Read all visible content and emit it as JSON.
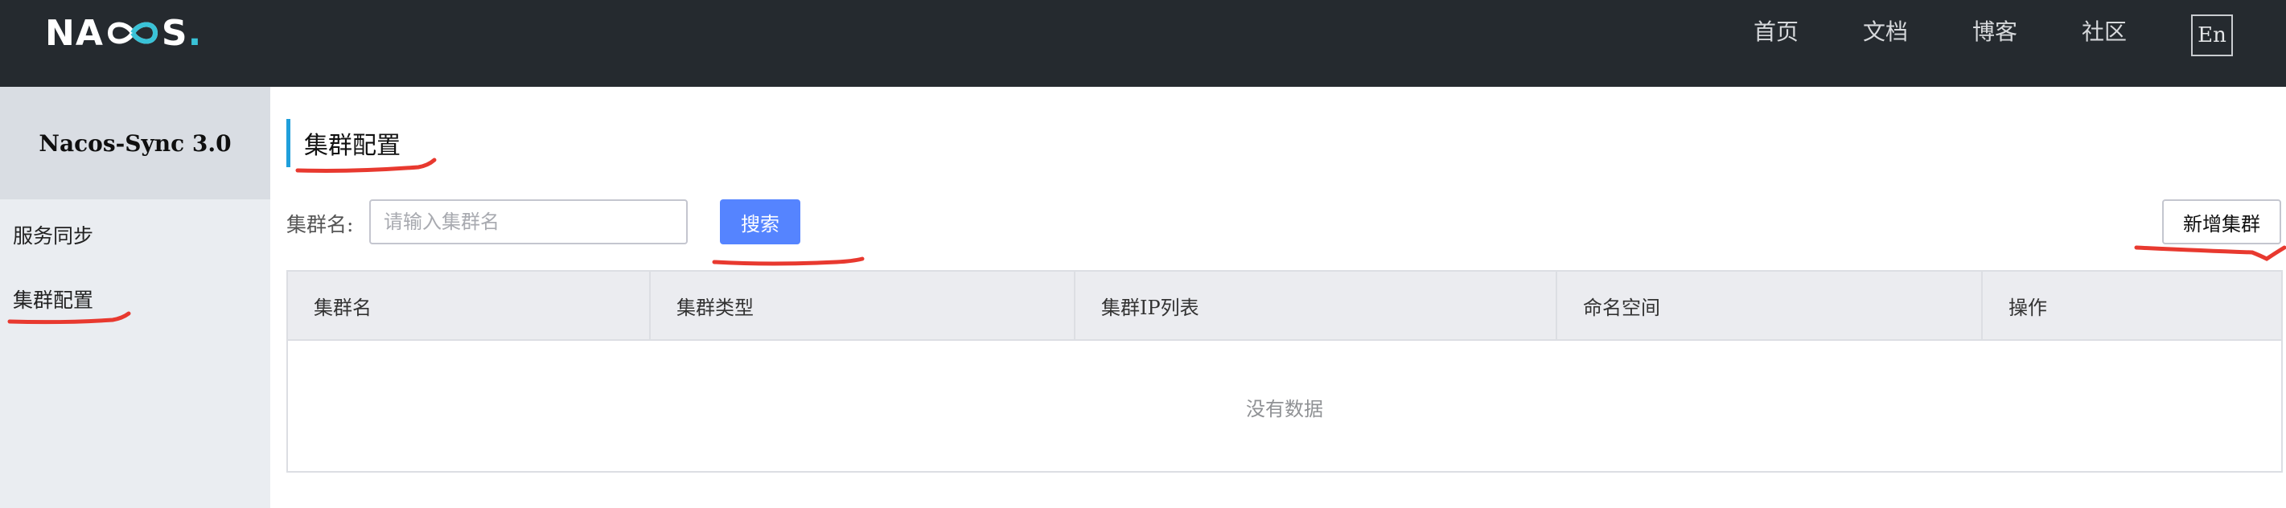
{
  "header": {
    "logo": {
      "text_left": "NA",
      "text_middle": "CO",
      "text_right": "S",
      "dot": ".",
      "accent_color": "#39c2d7"
    },
    "nav": [
      {
        "label": "首页"
      },
      {
        "label": "文档"
      },
      {
        "label": "博客"
      },
      {
        "label": "社区"
      }
    ],
    "lang_button": "En"
  },
  "sidebar": {
    "title": "Nacos-Sync 3.0",
    "items": [
      {
        "label": "服务同步"
      },
      {
        "label": "集群配置"
      }
    ]
  },
  "main": {
    "title": "集群配置",
    "search": {
      "label": "集群名:",
      "placeholder": "请输入集群名",
      "value": "",
      "button": "搜索"
    },
    "add_button": "新增集群",
    "table": {
      "columns": [
        {
          "label": "集群名"
        },
        {
          "label": "集群类型"
        },
        {
          "label": "集群IP列表"
        },
        {
          "label": "命名空间"
        },
        {
          "label": "操作"
        }
      ],
      "rows": [],
      "empty_text": "没有数据"
    }
  },
  "colors": {
    "header_bg": "#252a2f",
    "primary_button": "#5584ff",
    "title_accent": "#1f9fdb",
    "annotation": "#e8392f"
  }
}
